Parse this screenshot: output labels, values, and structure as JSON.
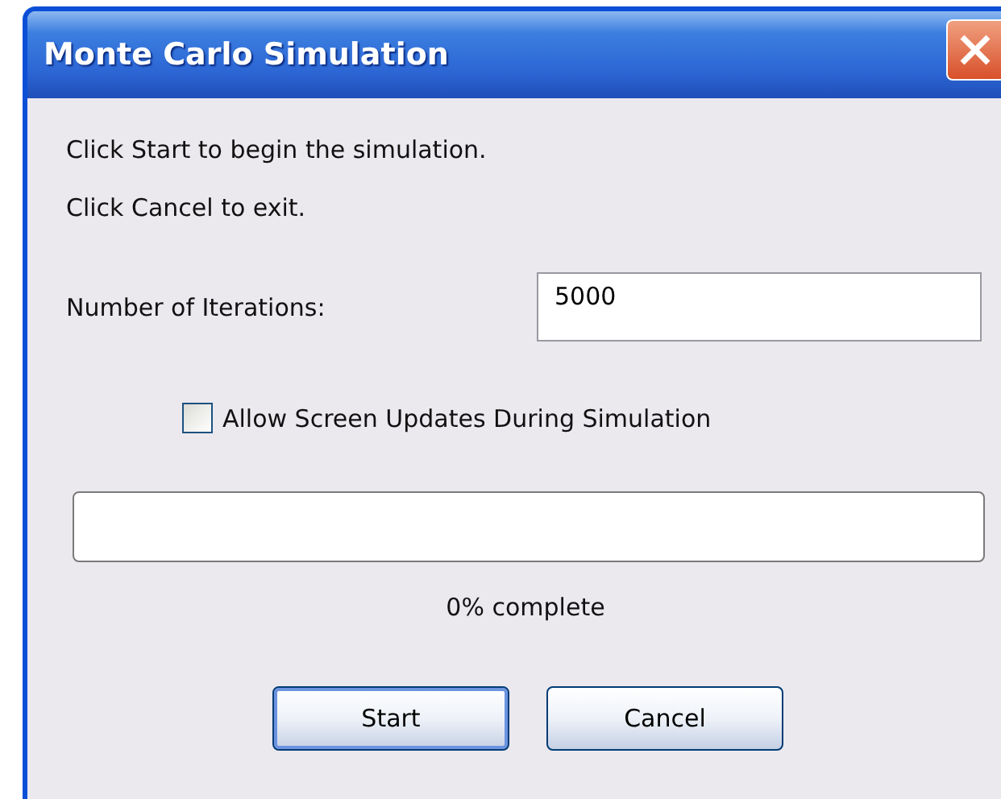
{
  "window": {
    "title": "Monte Carlo Simulation"
  },
  "instructions": [
    "Click Start to begin the simulation.",
    "Click Cancel to exit."
  ],
  "iterations": {
    "label": "Number of Iterations:",
    "value": "5000"
  },
  "screen_updates": {
    "label": "Allow Screen Updates During Simulation",
    "checked": false
  },
  "progress": {
    "level": 0,
    "reading": "0% complete"
  },
  "buttons": [
    {
      "label": "Start",
      "selected": true
    },
    {
      "label": "Cancel",
      "selected": false
    }
  ]
}
